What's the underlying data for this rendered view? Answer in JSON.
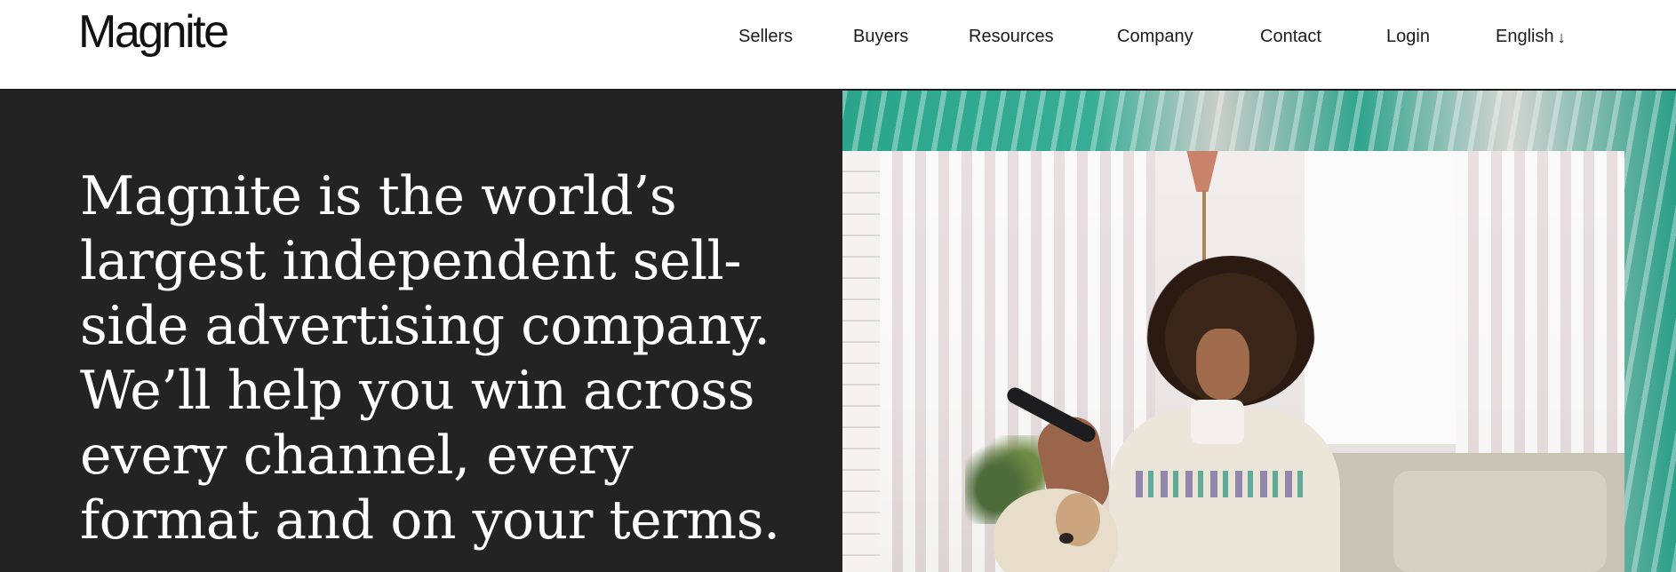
{
  "header": {
    "logo": "Magnite",
    "nav": {
      "sellers": "Sellers",
      "buyers": "Buyers",
      "resources": "Resources",
      "company": "Company",
      "contact": "Contact",
      "login": "Login",
      "language": "English",
      "language_icon": "arrow-down-icon"
    }
  },
  "hero": {
    "heading": "Magnite is the world’s largest independent sell-side advertising company. We’ll help you win across every channel, every format and on your terms.",
    "image_icon": "hero-photo"
  },
  "colors": {
    "hero_background": "#232323",
    "accent_teal": "#2aa58c",
    "text_dark": "#1a1a1a",
    "text_light": "#ffffff"
  }
}
